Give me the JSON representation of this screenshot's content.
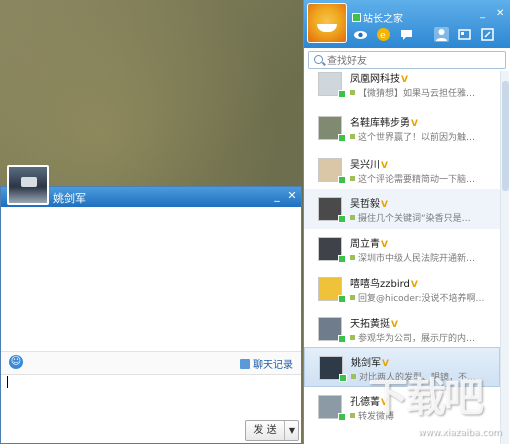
{
  "chat": {
    "title": "姚剑军",
    "history_label": "聊天记录",
    "input_value": "",
    "send_label": "发 送",
    "send_arrow": "▼",
    "minimize": "_",
    "close": "✕"
  },
  "panel": {
    "name": "站长之家",
    "minimize": "_",
    "close": "✕",
    "search_placeholder": "查找好友",
    "contacts": [
      {
        "name": "凤凰网科技",
        "verified": true,
        "signature": "【微猜想】如果马云担任雅…",
        "avatar_color": "#cfd6dc"
      },
      {
        "name": "名鞋库韩步勇",
        "verified": true,
        "signature": "这个世界赢了！以前因为触…",
        "avatar_color": "#7f8a70"
      },
      {
        "name": "吴兴川",
        "verified": true,
        "signature": "这个评论需要精简动一下脑…",
        "avatar_color": "#d9c7a8"
      },
      {
        "name": "吴哲毅",
        "verified": true,
        "signature": "摄住几个关键词“染香只是…",
        "avatar_color": "#4a4a4a"
      },
      {
        "name": "周立青",
        "verified": true,
        "signature": "深圳市中级人民法院开通新…",
        "avatar_color": "#3f4248"
      },
      {
        "name": "嘻嘻鸟zzbird",
        "verified": true,
        "signature": "回复@hicoder:没说不培养啊…",
        "avatar_color": "#f0c23a"
      },
      {
        "name": "天拓黄挺",
        "verified": true,
        "signature": "参观华为公司，展示厅的内…",
        "avatar_color": "#6e7c8c"
      },
      {
        "name": "姚剑军",
        "verified": true,
        "signature": "对比两人的发型、眼镜，不…",
        "avatar_color": "#2f3a48"
      },
      {
        "name": "孔德菁",
        "verified": true,
        "signature": "转发微博",
        "avatar_color": "#8c9aa6"
      }
    ]
  },
  "watermark": {
    "text": "下载吧",
    "url": "www.xiazaiba.com"
  }
}
